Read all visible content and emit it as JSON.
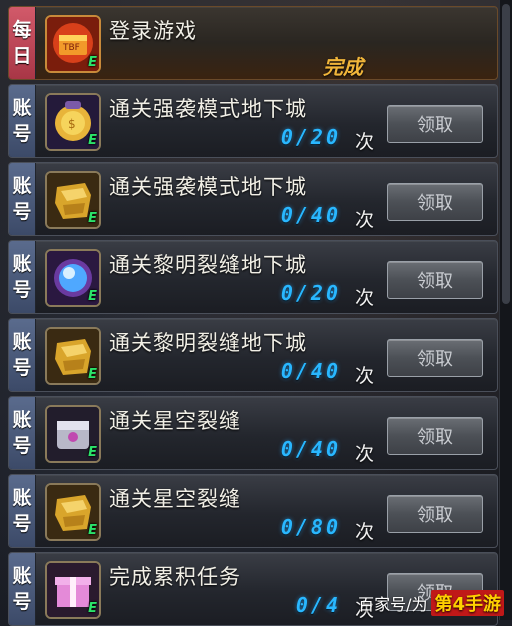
{
  "daily": {
    "tag": [
      "每",
      "日"
    ],
    "title": "登录游戏",
    "status": "完成",
    "icon": "treasure-chest-icon"
  },
  "tasks": [
    {
      "tag": [
        "账",
        "号"
      ],
      "title": "通关强袭模式地下城",
      "progress": "0/20",
      "unit": "次",
      "button": "领取",
      "icon": "gold-coin-bag-icon"
    },
    {
      "tag": [
        "账",
        "号"
      ],
      "title": "通关强袭模式地下城",
      "progress": "0/40",
      "unit": "次",
      "button": "领取",
      "icon": "golden-gauntlet-icon"
    },
    {
      "tag": [
        "账",
        "号"
      ],
      "title": "通关黎明裂缝地下城",
      "progress": "0/20",
      "unit": "次",
      "button": "领取",
      "icon": "blue-orb-icon"
    },
    {
      "tag": [
        "账",
        "号"
      ],
      "title": "通关黎明裂缝地下城",
      "progress": "0/40",
      "unit": "次",
      "button": "领取",
      "icon": "golden-gauntlet-icon"
    },
    {
      "tag": [
        "账",
        "号"
      ],
      "title": "通关星空裂缝",
      "progress": "0/40",
      "unit": "次",
      "button": "领取",
      "icon": "silver-chest-icon"
    },
    {
      "tag": [
        "账",
        "号"
      ],
      "title": "通关星空裂缝",
      "progress": "0/80",
      "unit": "次",
      "button": "领取",
      "icon": "golden-gauntlet-icon"
    },
    {
      "tag": [
        "账",
        "号"
      ],
      "title": "完成累积任务",
      "progress": "0/4",
      "unit": "次",
      "button": "领取",
      "icon": "pink-gift-box-icon"
    }
  ],
  "icon_badge": "E",
  "watermark": {
    "prefix": "百家号/为",
    "brand": "第4手游"
  },
  "colors": {
    "progress": "#29b7ff",
    "done": "#f0b53a",
    "daily_tag": "#d25a6a",
    "account_tag": "#5a6b8d"
  }
}
